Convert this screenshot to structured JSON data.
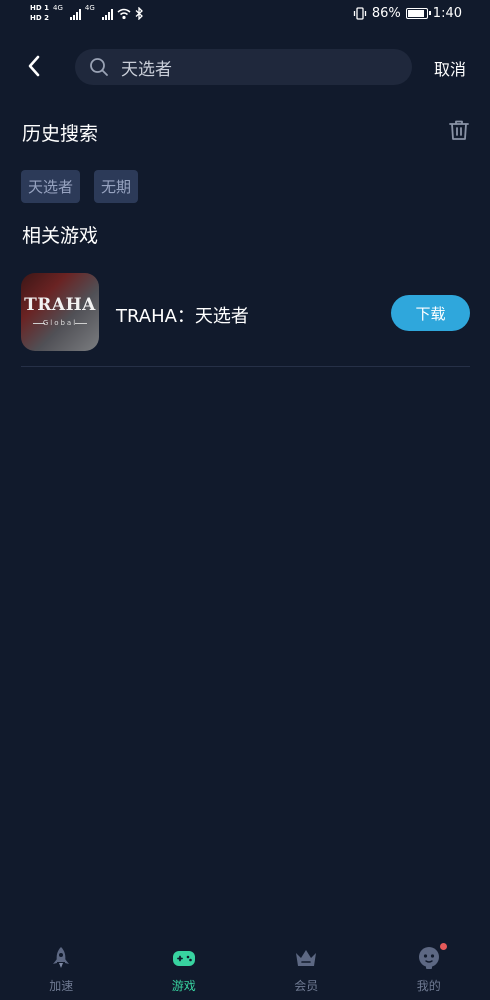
{
  "status_bar": {
    "hd1": "HD 1",
    "hd2": "HD 2",
    "net1": "4G",
    "net2": "4G",
    "battery_percent": "86%",
    "time": "1:40",
    "battery_level": 0.86
  },
  "search": {
    "value": "天选者",
    "cancel_label": "取消"
  },
  "history": {
    "title": "历史搜索",
    "tags": [
      "天选者",
      "无期"
    ]
  },
  "related": {
    "title": "相关游戏",
    "games": [
      {
        "name": "TRAHA：天选者",
        "icon_logo": "TRAHA",
        "icon_sublogo": "Global",
        "download_label": "下载"
      }
    ]
  },
  "bottom_nav": {
    "items": [
      {
        "label": "加速",
        "icon": "rocket-icon"
      },
      {
        "label": "游戏",
        "icon": "gamepad-icon"
      },
      {
        "label": "会员",
        "icon": "crown-icon"
      },
      {
        "label": "我的",
        "icon": "profile-icon"
      }
    ],
    "active_index": 1
  },
  "colors": {
    "background": "#111a2c",
    "accent_green": "#38d3a0",
    "download_blue": "#2fa7dc",
    "tag_bg": "#2c3a58"
  }
}
